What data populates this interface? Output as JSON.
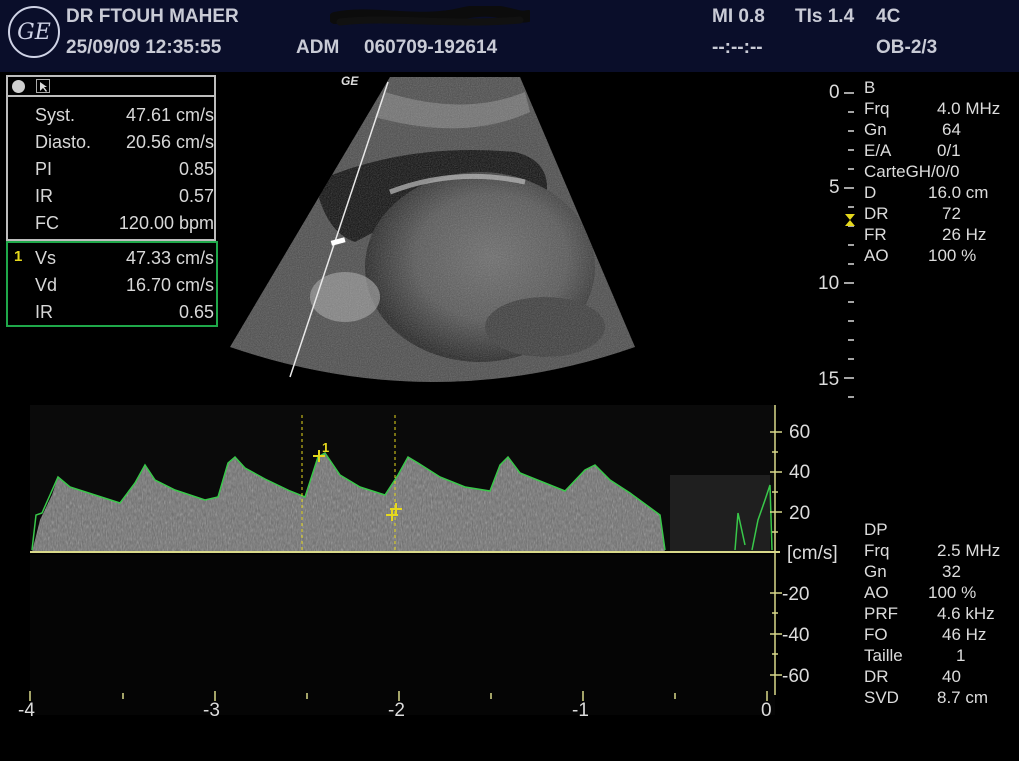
{
  "header": {
    "logo_text": "GE",
    "operator": "DR FTOUH MAHER",
    "datetime": "25/09/09 12:35:55",
    "adm": "ADM",
    "patient_id": "060709-192614",
    "mi": "MI 0.8",
    "tis": "TIs 1.4",
    "probe": "4C",
    "preset": "OB-2/3",
    "timer": "--:--:--"
  },
  "measurements": {
    "top": [
      {
        "label": "Syst.",
        "value": "47.61 cm/s"
      },
      {
        "label": "Diasto.",
        "value": "20.56 cm/s"
      },
      {
        "label": "PI",
        "value": "0.85"
      },
      {
        "label": "IR",
        "value": "0.57"
      },
      {
        "label": "FC",
        "value": "120.00 bpm"
      }
    ],
    "active_marker": "1",
    "active": [
      {
        "label": "Vs",
        "value": "47.33 cm/s"
      },
      {
        "label": "Vd",
        "value": "16.70 cm/s"
      },
      {
        "label": "IR",
        "value": "0.65"
      }
    ]
  },
  "image": {
    "brand_label": "GE",
    "depth_ticks": [
      "0",
      "5",
      "10",
      "15"
    ]
  },
  "bmode_params": [
    {
      "label": "B",
      "value": ""
    },
    {
      "label": "Frq",
      "value": "4.0 MHz"
    },
    {
      "label": "Gn",
      "value": "64"
    },
    {
      "label": "E/A",
      "value": "0/1"
    },
    {
      "label": "CarteGH/0/0",
      "value": ""
    },
    {
      "label": "D",
      "value": "16.0 cm"
    },
    {
      "label": "DR",
      "value": "72"
    },
    {
      "label": "FR",
      "value": "26 Hz"
    },
    {
      "label": "AO",
      "value": "100 %"
    }
  ],
  "doppler_params": [
    {
      "label": "DP",
      "value": ""
    },
    {
      "label": "Frq",
      "value": "2.5 MHz"
    },
    {
      "label": "Gn",
      "value": "32"
    },
    {
      "label": "AO",
      "value": "100 %"
    },
    {
      "label": "PRF",
      "value": "4.6 kHz"
    },
    {
      "label": "FO",
      "value": "46 Hz"
    },
    {
      "label": "Taille",
      "value": "1"
    },
    {
      "label": "DR",
      "value": "40"
    },
    {
      "label": "SVD",
      "value": "8.7 cm"
    }
  ],
  "doppler": {
    "velocity_unit": "[cm/s]",
    "velocity_ticks": [
      "60",
      "40",
      "20",
      "-20",
      "-40",
      "-60"
    ],
    "time_ticks": [
      "-4",
      "-3",
      "-2",
      "-1",
      "0"
    ],
    "cursor_marker": "1",
    "colors": {
      "envelope": "#39c84a",
      "cursor": "#e5d81c",
      "baseline": "#d9d98a"
    }
  }
}
